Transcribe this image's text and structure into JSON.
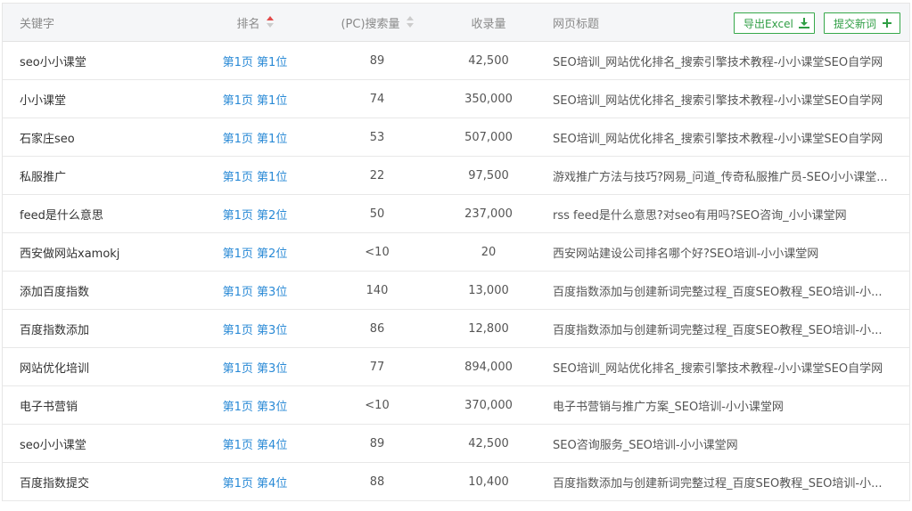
{
  "header": {
    "keyword": "关键字",
    "rank": "排名",
    "search_volume": "(PC)搜索量",
    "indexed": "收录量",
    "page_title": "网页标题",
    "export_button": "导出Excel",
    "submit_button": "提交新词"
  },
  "colors": {
    "link": "#2a8ad6",
    "button_green": "#36a84a",
    "sort_active": "#e24a4a"
  },
  "rows": [
    {
      "keyword": "seo小小课堂",
      "rank": "第1页 第1位",
      "search": "89",
      "indexed": "42,500",
      "title": "SEO培训_网站优化排名_搜索引擎技术教程-小小课堂SEO自学网"
    },
    {
      "keyword": "小小课堂",
      "rank": "第1页 第1位",
      "search": "74",
      "indexed": "350,000",
      "title": "SEO培训_网站优化排名_搜索引擎技术教程-小小课堂SEO自学网"
    },
    {
      "keyword": "石家庄seo",
      "rank": "第1页 第1位",
      "search": "53",
      "indexed": "507,000",
      "title": "SEO培训_网站优化排名_搜索引擎技术教程-小小课堂SEO自学网"
    },
    {
      "keyword": "私服推广",
      "rank": "第1页 第1位",
      "search": "22",
      "indexed": "97,500",
      "title": "游戏推广方法与技巧?网易_问道_传奇私服推广员-SEO小小课堂..."
    },
    {
      "keyword": "feed是什么意思",
      "rank": "第1页 第2位",
      "search": "50",
      "indexed": "237,000",
      "title": "rss feed是什么意思?对seo有用吗?SEO咨询_小小课堂网"
    },
    {
      "keyword": "西安做网站xamokj",
      "rank": "第1页 第2位",
      "search": "<10",
      "indexed": "20",
      "title": "西安网站建设公司排名哪个好?SEO培训-小小课堂网"
    },
    {
      "keyword": "添加百度指数",
      "rank": "第1页 第3位",
      "search": "140",
      "indexed": "13,000",
      "title": "百度指数添加与创建新词完整过程_百度SEO教程_SEO培训-小..."
    },
    {
      "keyword": "百度指数添加",
      "rank": "第1页 第3位",
      "search": "86",
      "indexed": "12,800",
      "title": "百度指数添加与创建新词完整过程_百度SEO教程_SEO培训-小..."
    },
    {
      "keyword": "网站优化培训",
      "rank": "第1页 第3位",
      "search": "77",
      "indexed": "894,000",
      "title": "SEO培训_网站优化排名_搜索引擎技术教程-小小课堂SEO自学网"
    },
    {
      "keyword": "电子书营销",
      "rank": "第1页 第3位",
      "search": "<10",
      "indexed": "370,000",
      "title": "电子书营销与推广方案_SEO培训-小小课堂网"
    },
    {
      "keyword": "seo小小课堂",
      "rank": "第1页 第4位",
      "search": "89",
      "indexed": "42,500",
      "title": "SEO咨询服务_SEO培训-小小课堂网"
    },
    {
      "keyword": "百度指数提交",
      "rank": "第1页 第4位",
      "search": "88",
      "indexed": "10,400",
      "title": "百度指数添加与创建新词完整过程_百度SEO教程_SEO培训-小..."
    }
  ]
}
